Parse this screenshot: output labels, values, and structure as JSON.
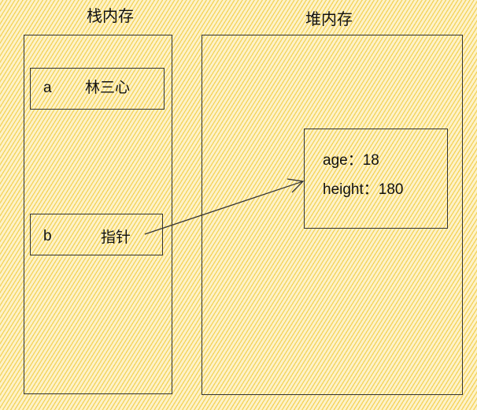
{
  "stack": {
    "title": "栈内存",
    "var_a": {
      "name": "a",
      "value": "林三心"
    },
    "var_b": {
      "name": "b",
      "value": "指针"
    }
  },
  "heap": {
    "title": "堆内存",
    "object": {
      "line1": "age：18",
      "line2": "height：180"
    }
  },
  "colors": {
    "background": "#fdf2c9",
    "hatch": "#f4d35a",
    "stroke": "#333333"
  }
}
